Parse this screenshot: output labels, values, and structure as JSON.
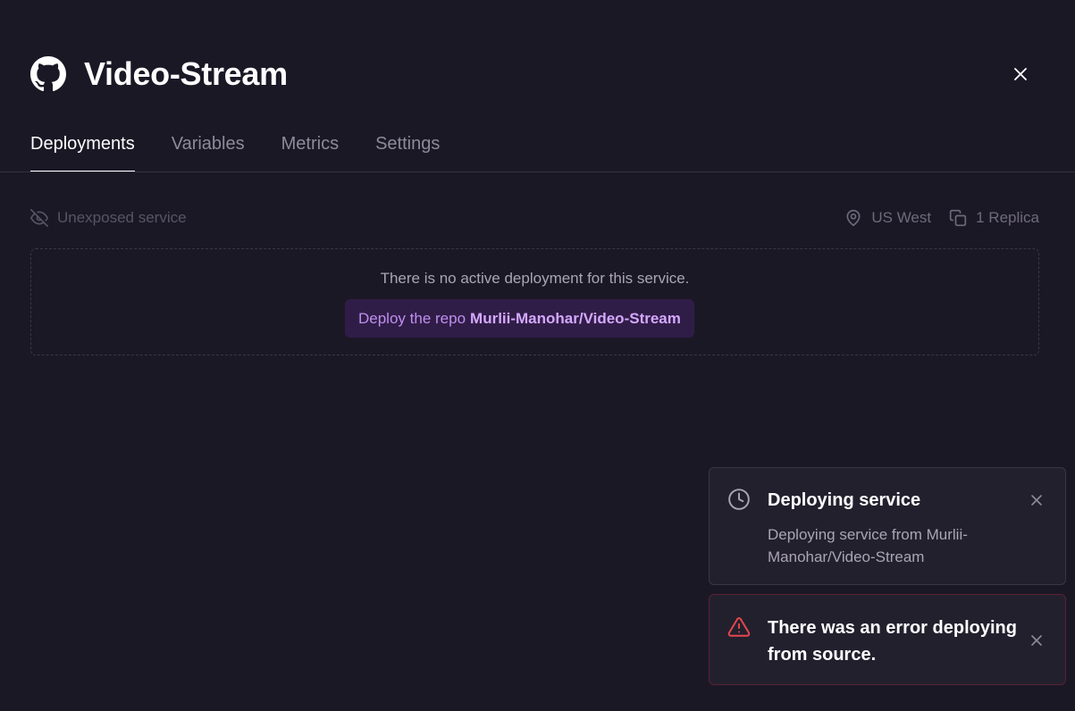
{
  "service": {
    "title": "Video-Stream",
    "icon": "github-icon"
  },
  "tabs": [
    {
      "label": "Deployments",
      "active": true
    },
    {
      "label": "Variables",
      "active": false
    },
    {
      "label": "Metrics",
      "active": false
    },
    {
      "label": "Settings",
      "active": false
    }
  ],
  "meta": {
    "exposure": "Unexposed service",
    "region": "US West",
    "replicas": "1 Replica"
  },
  "deployment": {
    "empty_message": "There is no active deployment for this service.",
    "deploy_prefix": "Deploy the repo",
    "repo": "Murlii-Manohar/Video-Stream"
  },
  "toasts": {
    "info": {
      "title": "Deploying service",
      "body": "Deploying service from Murlii-Manohar/Video-Stream",
      "icon": "clock-icon"
    },
    "error": {
      "title": "There was an error deploying from source.",
      "icon": "warning-triangle-icon",
      "color": "#e5484d"
    }
  },
  "colors": {
    "background": "#1b1826",
    "accent": "#bf8ff0",
    "accent_bg": "#301d47"
  }
}
